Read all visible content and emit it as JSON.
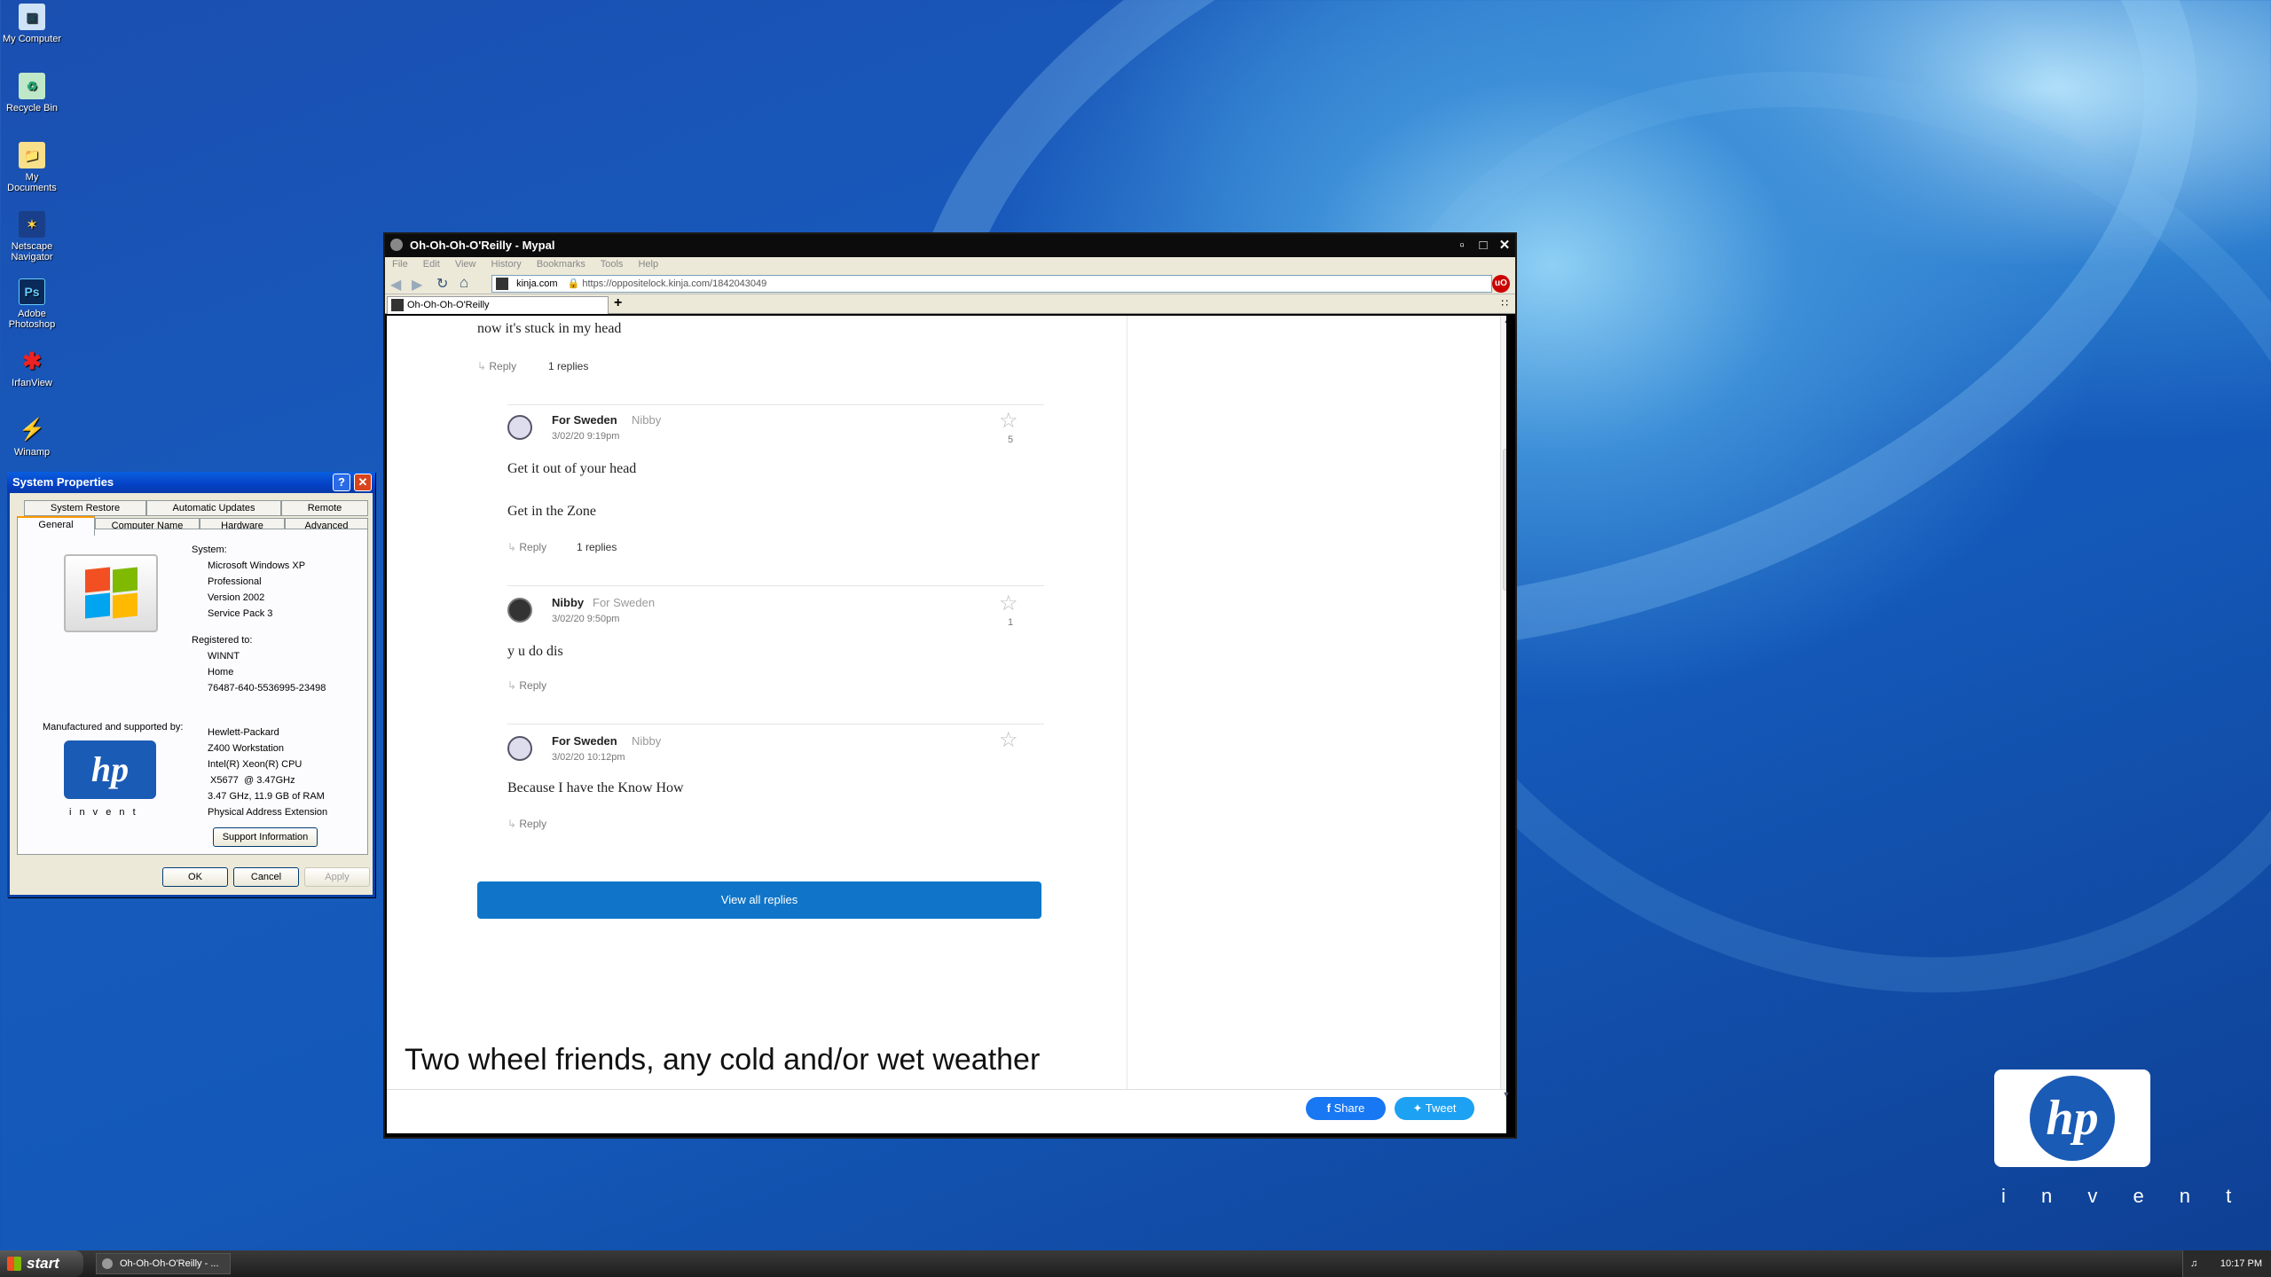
{
  "desktop": {
    "icons": [
      {
        "label": "My Computer",
        "icon": "my-computer-icon"
      },
      {
        "label": "Recycle Bin",
        "icon": "recycle-bin-icon"
      },
      {
        "label": "My Documents",
        "icon": "my-documents-icon"
      },
      {
        "label": "Netscape Navigator",
        "icon": "netscape-icon"
      },
      {
        "label": "Adobe Photoshop",
        "icon": "photoshop-icon"
      },
      {
        "label": "IrfanView",
        "icon": "irfanview-icon"
      },
      {
        "label": "Winamp",
        "icon": "winamp-icon"
      }
    ],
    "hp_invent": "i n v e n t"
  },
  "system_properties": {
    "title": "System Properties",
    "tabs_back": [
      "System Restore",
      "Automatic Updates",
      "Remote"
    ],
    "tabs_front": [
      "General",
      "Computer Name",
      "Hardware",
      "Advanced"
    ],
    "system_label": "System:",
    "system_lines": [
      "Microsoft Windows XP",
      "Professional",
      "Version 2002",
      "Service Pack 3"
    ],
    "registered_label": "Registered to:",
    "registered_lines": [
      "WINNT",
      "Home",
      "76487-640-5536995-23498"
    ],
    "manufactured_label": "Manufactured and supported by:",
    "manufacturer_lines": [
      "Hewlett-Packard",
      "Z400 Workstation",
      "Intel(R) Xeon(R) CPU",
      " X5677  @ 3.47GHz",
      "3.47 GHz, 11.9 GB of RAM",
      "Physical Address Extension"
    ],
    "hp_invent": "i n v e n t",
    "support_button": "Support Information",
    "ok": "OK",
    "cancel": "Cancel",
    "apply": "Apply"
  },
  "browser": {
    "title": "Oh-Oh-Oh-O'Reilly - Mypal",
    "menu": [
      "File",
      "Edit",
      "View",
      "History",
      "Bookmarks",
      "Tools",
      "Help"
    ],
    "site_badge": "kinja.com",
    "url": "https://oppositelock.kinja.com/1842043049",
    "tab_label": "Oh-Oh-Oh-O'Reilly",
    "new_tab": "+",
    "comments": {
      "top_text": "now it's stuck in my head",
      "top_reply": "Reply",
      "top_replies": "1 replies",
      "items": [
        {
          "author": "For Sweden",
          "to": "Nibby",
          "time": "3/02/20 9:19pm",
          "stars": "5",
          "lines": [
            "Get it out of your head",
            "Get in the Zone"
          ],
          "reply": "Reply",
          "replies": "1 replies"
        },
        {
          "author": "Nibby",
          "to": "For Sweden",
          "time": "3/02/20 9:50pm",
          "stars": "1",
          "lines": [
            "y u do dis"
          ],
          "reply": "Reply",
          "replies": ""
        },
        {
          "author": "For Sweden",
          "to": "Nibby",
          "time": "3/02/20 10:12pm",
          "stars": "",
          "lines": [
            "Because I have the Know How"
          ],
          "reply": "Reply",
          "replies": ""
        }
      ],
      "view_all": "View all replies"
    },
    "next_headline": "Two wheel friends, any cold and/or wet weather",
    "share": "Share",
    "tweet": "Tweet"
  },
  "taskbar": {
    "start": "start",
    "task": "Oh-Oh-Oh-O'Reilly - ...",
    "clock": "10:17 PM"
  }
}
